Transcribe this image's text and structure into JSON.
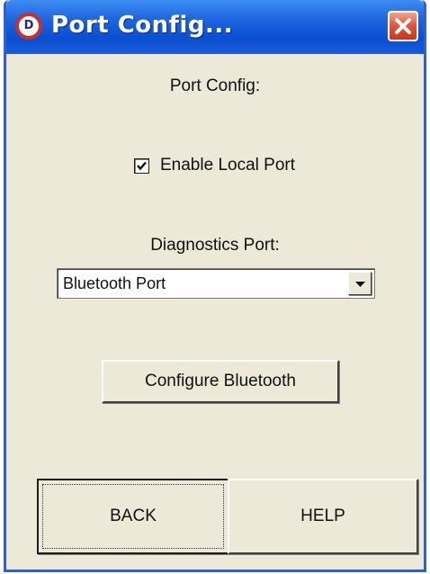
{
  "window": {
    "title": "Port Config...",
    "icon_letter": "D",
    "icon": "app-logo-icon",
    "close_icon": "close-icon"
  },
  "main": {
    "heading": "Port Config:",
    "enable_local_port": {
      "label": "Enable Local Port",
      "checked": true
    },
    "diagnostics_port": {
      "label": "Diagnostics Port:",
      "selected": "Bluetooth Port"
    },
    "configure_bluetooth_label": "Configure Bluetooth"
  },
  "footer": {
    "back_label": "BACK",
    "help_label": "HELP"
  },
  "colors": {
    "titlebar": "#0a4fd1",
    "dialog_bg": "#ece9d8",
    "close_button": "#e25a3a"
  }
}
